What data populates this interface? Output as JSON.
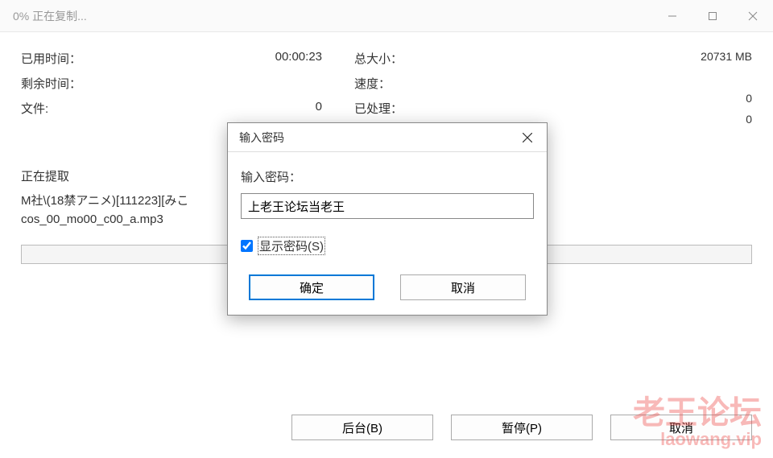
{
  "window": {
    "title": "0% 正在复制..."
  },
  "stats": {
    "elapsed_label": "已用时间：",
    "elapsed_value": "00:00:23",
    "remaining_label": "剩余时间：",
    "files_label": "文件:",
    "files_value": "0",
    "totalsize_label": "总大小：",
    "totalsize_value": "20731 MB",
    "speed_label": "速度：",
    "processed_label": "已处理：",
    "processed_value": "0",
    "ratio_value": "0"
  },
  "extraction": {
    "heading": "正在提取",
    "path": "M社\\(18禁アニメ)[111223][みこ\ncos_00_mo00_c00_a.mp3"
  },
  "footer": {
    "background_label": "后台(B)",
    "pause_label": "暂停(P)",
    "cancel_label": "取消"
  },
  "modal": {
    "title": "输入密码",
    "label": "输入密码：",
    "value": "上老王论坛当老王",
    "show_password_label": "显示密码(S)",
    "show_password_checked": true,
    "ok_label": "确定",
    "cancel_label": "取消"
  },
  "watermark": {
    "cn": "老王论坛",
    "en": "laowang.vip"
  }
}
